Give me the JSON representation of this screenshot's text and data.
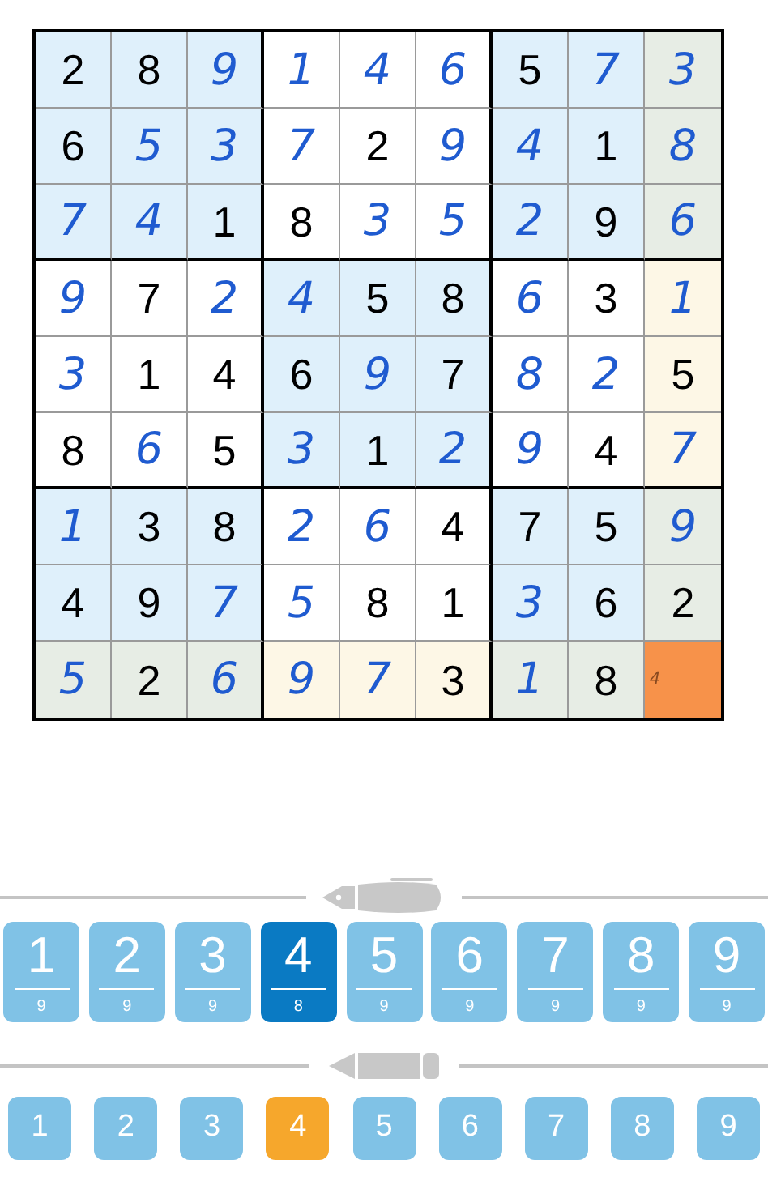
{
  "grid": [
    [
      {
        "value": "2",
        "kind": "given",
        "highlighted": false,
        "selected": false
      },
      {
        "value": "8",
        "kind": "given",
        "highlighted": false,
        "selected": false
      },
      {
        "value": "9",
        "kind": "entered",
        "highlighted": false,
        "selected": false
      },
      {
        "value": "1",
        "kind": "entered",
        "highlighted": false,
        "selected": false
      },
      {
        "value": "4",
        "kind": "entered",
        "highlighted": false,
        "selected": false
      },
      {
        "value": "6",
        "kind": "entered",
        "highlighted": false,
        "selected": false
      },
      {
        "value": "5",
        "kind": "given",
        "highlighted": false,
        "selected": false
      },
      {
        "value": "7",
        "kind": "entered",
        "highlighted": false,
        "selected": false
      },
      {
        "value": "3",
        "kind": "entered",
        "highlighted": true,
        "selected": false
      }
    ],
    [
      {
        "value": "6",
        "kind": "given",
        "highlighted": false,
        "selected": false
      },
      {
        "value": "5",
        "kind": "entered",
        "highlighted": false,
        "selected": false
      },
      {
        "value": "3",
        "kind": "entered",
        "highlighted": false,
        "selected": false
      },
      {
        "value": "7",
        "kind": "entered",
        "highlighted": false,
        "selected": false
      },
      {
        "value": "2",
        "kind": "given",
        "highlighted": false,
        "selected": false
      },
      {
        "value": "9",
        "kind": "entered",
        "highlighted": false,
        "selected": false
      },
      {
        "value": "4",
        "kind": "entered",
        "highlighted": false,
        "selected": false
      },
      {
        "value": "1",
        "kind": "given",
        "highlighted": false,
        "selected": false
      },
      {
        "value": "8",
        "kind": "entered",
        "highlighted": true,
        "selected": false
      }
    ],
    [
      {
        "value": "7",
        "kind": "entered",
        "highlighted": false,
        "selected": false
      },
      {
        "value": "4",
        "kind": "entered",
        "highlighted": false,
        "selected": false
      },
      {
        "value": "1",
        "kind": "given",
        "highlighted": false,
        "selected": false
      },
      {
        "value": "8",
        "kind": "given",
        "highlighted": false,
        "selected": false
      },
      {
        "value": "3",
        "kind": "entered",
        "highlighted": false,
        "selected": false
      },
      {
        "value": "5",
        "kind": "entered",
        "highlighted": false,
        "selected": false
      },
      {
        "value": "2",
        "kind": "entered",
        "highlighted": false,
        "selected": false
      },
      {
        "value": "9",
        "kind": "given",
        "highlighted": false,
        "selected": false
      },
      {
        "value": "6",
        "kind": "entered",
        "highlighted": true,
        "selected": false
      }
    ],
    [
      {
        "value": "9",
        "kind": "entered",
        "highlighted": false,
        "selected": false
      },
      {
        "value": "7",
        "kind": "given",
        "highlighted": false,
        "selected": false
      },
      {
        "value": "2",
        "kind": "entered",
        "highlighted": false,
        "selected": false
      },
      {
        "value": "4",
        "kind": "entered",
        "highlighted": false,
        "selected": false
      },
      {
        "value": "5",
        "kind": "given",
        "highlighted": false,
        "selected": false
      },
      {
        "value": "8",
        "kind": "given",
        "highlighted": false,
        "selected": false
      },
      {
        "value": "6",
        "kind": "entered",
        "highlighted": false,
        "selected": false
      },
      {
        "value": "3",
        "kind": "given",
        "highlighted": false,
        "selected": false
      },
      {
        "value": "1",
        "kind": "entered",
        "highlighted": true,
        "selected": false
      }
    ],
    [
      {
        "value": "3",
        "kind": "entered",
        "highlighted": false,
        "selected": false
      },
      {
        "value": "1",
        "kind": "given",
        "highlighted": false,
        "selected": false
      },
      {
        "value": "4",
        "kind": "given",
        "highlighted": false,
        "selected": false
      },
      {
        "value": "6",
        "kind": "given",
        "highlighted": false,
        "selected": false
      },
      {
        "value": "9",
        "kind": "entered",
        "highlighted": false,
        "selected": false
      },
      {
        "value": "7",
        "kind": "given",
        "highlighted": false,
        "selected": false
      },
      {
        "value": "8",
        "kind": "entered",
        "highlighted": false,
        "selected": false
      },
      {
        "value": "2",
        "kind": "entered",
        "highlighted": false,
        "selected": false
      },
      {
        "value": "5",
        "kind": "given",
        "highlighted": true,
        "selected": false
      }
    ],
    [
      {
        "value": "8",
        "kind": "given",
        "highlighted": false,
        "selected": false
      },
      {
        "value": "6",
        "kind": "entered",
        "highlighted": false,
        "selected": false
      },
      {
        "value": "5",
        "kind": "given",
        "highlighted": false,
        "selected": false
      },
      {
        "value": "3",
        "kind": "entered",
        "highlighted": false,
        "selected": false
      },
      {
        "value": "1",
        "kind": "given",
        "highlighted": false,
        "selected": false
      },
      {
        "value": "2",
        "kind": "entered",
        "highlighted": false,
        "selected": false
      },
      {
        "value": "9",
        "kind": "entered",
        "highlighted": false,
        "selected": false
      },
      {
        "value": "4",
        "kind": "given",
        "highlighted": false,
        "selected": false
      },
      {
        "value": "7",
        "kind": "entered",
        "highlighted": true,
        "selected": false
      }
    ],
    [
      {
        "value": "1",
        "kind": "entered",
        "highlighted": false,
        "selected": false
      },
      {
        "value": "3",
        "kind": "given",
        "highlighted": false,
        "selected": false
      },
      {
        "value": "8",
        "kind": "given",
        "highlighted": false,
        "selected": false
      },
      {
        "value": "2",
        "kind": "entered",
        "highlighted": false,
        "selected": false
      },
      {
        "value": "6",
        "kind": "entered",
        "highlighted": false,
        "selected": false
      },
      {
        "value": "4",
        "kind": "given",
        "highlighted": false,
        "selected": false
      },
      {
        "value": "7",
        "kind": "given",
        "highlighted": false,
        "selected": false
      },
      {
        "value": "5",
        "kind": "given",
        "highlighted": false,
        "selected": false
      },
      {
        "value": "9",
        "kind": "entered",
        "highlighted": true,
        "selected": false
      }
    ],
    [
      {
        "value": "4",
        "kind": "given",
        "highlighted": false,
        "selected": false
      },
      {
        "value": "9",
        "kind": "given",
        "highlighted": false,
        "selected": false
      },
      {
        "value": "7",
        "kind": "entered",
        "highlighted": false,
        "selected": false
      },
      {
        "value": "5",
        "kind": "entered",
        "highlighted": false,
        "selected": false
      },
      {
        "value": "8",
        "kind": "given",
        "highlighted": false,
        "selected": false
      },
      {
        "value": "1",
        "kind": "given",
        "highlighted": false,
        "selected": false
      },
      {
        "value": "3",
        "kind": "entered",
        "highlighted": false,
        "selected": false
      },
      {
        "value": "6",
        "kind": "given",
        "highlighted": false,
        "selected": false
      },
      {
        "value": "2",
        "kind": "given",
        "highlighted": true,
        "selected": false
      }
    ],
    [
      {
        "value": "5",
        "kind": "entered",
        "highlighted": true,
        "selected": false
      },
      {
        "value": "2",
        "kind": "given",
        "highlighted": true,
        "selected": false
      },
      {
        "value": "6",
        "kind": "entered",
        "highlighted": true,
        "selected": false
      },
      {
        "value": "9",
        "kind": "entered",
        "highlighted": true,
        "selected": false
      },
      {
        "value": "7",
        "kind": "entered",
        "highlighted": true,
        "selected": false
      },
      {
        "value": "3",
        "kind": "given",
        "highlighted": true,
        "selected": false
      },
      {
        "value": "1",
        "kind": "entered",
        "highlighted": true,
        "selected": false
      },
      {
        "value": "8",
        "kind": "given",
        "highlighted": true,
        "selected": false
      },
      {
        "value": "4",
        "kind": "note",
        "highlighted": false,
        "selected": true
      }
    ]
  ],
  "pen_digits": [
    {
      "digit": "1",
      "count": "9",
      "selected": false
    },
    {
      "digit": "2",
      "count": "9",
      "selected": false
    },
    {
      "digit": "3",
      "count": "9",
      "selected": false
    },
    {
      "digit": "4",
      "count": "8",
      "selected": true
    },
    {
      "digit": "5",
      "count": "9",
      "selected": false
    },
    {
      "digit": "6",
      "count": "9",
      "selected": false
    },
    {
      "digit": "7",
      "count": "9",
      "selected": false
    },
    {
      "digit": "8",
      "count": "9",
      "selected": false
    },
    {
      "digit": "9",
      "count": "9",
      "selected": false
    }
  ],
  "pencil_digits": [
    {
      "digit": "1",
      "selected": false
    },
    {
      "digit": "2",
      "selected": false
    },
    {
      "digit": "3",
      "selected": false
    },
    {
      "digit": "4",
      "selected": true
    },
    {
      "digit": "5",
      "selected": false
    },
    {
      "digit": "6",
      "selected": false
    },
    {
      "digit": "7",
      "selected": false
    },
    {
      "digit": "8",
      "selected": false
    },
    {
      "digit": "9",
      "selected": false
    }
  ]
}
